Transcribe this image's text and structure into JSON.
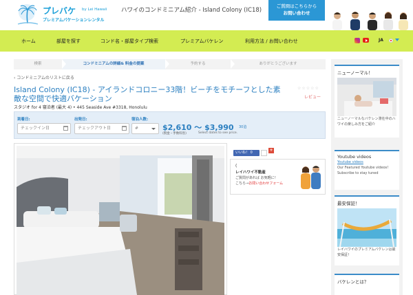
{
  "header": {
    "logo_main": "プレバケ",
    "logo_by": "by Lei Hawaii",
    "logo_sub": "プレミアムバケーションレンタル",
    "site_title": "ハワイのコンドミニアム紹介 - Island Colony (IC18)",
    "contact_line1": "ご質問はこちらから",
    "contact_line2": "お問い合わせ"
  },
  "nav": {
    "items": [
      "ホーム",
      "部屋を探す",
      "コンド名・部屋タイプ検索",
      "プレミアムバケレン",
      "利用方法 / お問い合わせ"
    ],
    "lang": "JA"
  },
  "steps": [
    "検索",
    "コンドミニアムの詳細& 料金の提案",
    "予約する",
    "ありがとうございます"
  ],
  "back_link": "‹ コンドミニアムのリストに戻る",
  "listing": {
    "title": "Island Colony (IC18) - アイランドコロニー33階！ビーチをモチーフとした素敵な空間で快適バケーション",
    "stars": "☆☆☆☆☆",
    "review_link": "レビュー",
    "subline": "スタジオ for 4 寝泊者 (最大 4) • 445 Seaside Ave #3318, Honolulu"
  },
  "booking": {
    "checkin_label": "到着日:",
    "checkin_placeholder": "チェックイン日",
    "checkout_label": "出発日:",
    "checkout_placeholder": "チェックアウト日",
    "guests_label": "宿泊人数:",
    "guests_value": "#",
    "price_range": "$2,610 〜 $3,990",
    "price_unit": "30泊",
    "price_note1": "(税金・手数料別)",
    "price_note2": "Select dates to see price."
  },
  "social": {
    "like_label": "いいね！ 0",
    "like_count": "",
    "gplus": "+"
  },
  "agent": {
    "mark": "(",
    "name": "レイハワイ不動産",
    "text1": "ご質問があれば お気軽に！",
    "text2_prefix": "こちら→",
    "text2_link": "お問い合わせフォーム"
  },
  "sidebar": {
    "new_normal_title": "ニューノーマル！",
    "new_normal_text": "ニューノーマルなバケレン滞在中のハワイの楽しみ方をご紹介",
    "youtube_title": "Youtube videos",
    "youtube_img_alt": "Youtube videos",
    "youtube_text": "Our Featured Youtube videos! Subscribe to stay tuned",
    "guarantee_title": "最安保証！",
    "guarantee_text": "レイハワイのプレミアムバケレンは最安保証！",
    "about_title": "バケレンとは？"
  },
  "colors": {
    "nav_bg": "#d3ec52",
    "accent_blue": "#2b7fc0",
    "contact_btn": "#2b97d5",
    "review_red": "#e06060"
  }
}
